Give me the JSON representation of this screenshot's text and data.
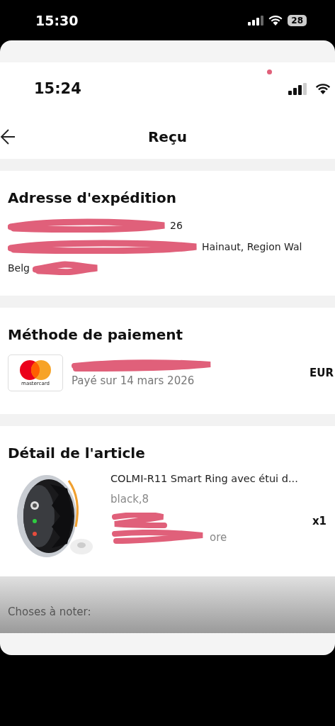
{
  "status_bar": {
    "time": "15:30",
    "battery": "28"
  },
  "inner_status_bar": {
    "time": "15:24"
  },
  "header": {
    "title": "Reçu"
  },
  "shipping": {
    "title": "Adresse d'expédition",
    "lines": [
      {
        "visible_text": "26"
      },
      {
        "visible_text": "Hainaut, Region Wal"
      },
      {
        "visible_text": "Belg"
      }
    ]
  },
  "payment": {
    "title": "Méthode de paiement",
    "card_label": "mastercard",
    "date": "Payé sur 14 mars 2026",
    "currency": "EUR"
  },
  "item": {
    "title": "Détail de l'article",
    "name": "COLMI-R11 Smart Ring avec étui d...",
    "variant": "black,8",
    "quantity": "x1",
    "shipping_fragment": "ore"
  },
  "notes": {
    "title": "Choses à noter:"
  }
}
